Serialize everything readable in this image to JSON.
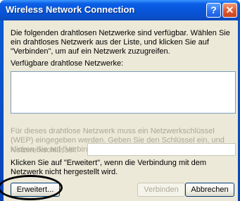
{
  "window": {
    "title": "Wireless Network Connection",
    "help_icon": "?",
    "close_icon": "✕"
  },
  "dialog": {
    "intro": "Die folgenden drahtlosen Netzwerke sind verfügbar. Wählen Sie ein drahtloses Netzwerk aus der Liste, und klicken Sie auf \"Verbinden\", um auf ein Netzwerk zuzugreifen.",
    "available_label": "Verfügbare drahtlose Netzwerke:",
    "available_networks": [],
    "wep_note": "Für dieses drahtlose Netzwerk muss ein Netzwerkschlüssel (WEP) eingegeben werden. Geben Sie den Schlüssel ein, und klicken Sie auf \"Verbinden\", um auf dieses Netzwerk zuzugreifen.",
    "key_label": "Netzwerkschlüssel:",
    "key_value": "",
    "advanced_note": "Klicken Sie auf \"Erweitert\", wenn die Verbindung mit dem Netzwerk nicht hergestellt wird."
  },
  "buttons": {
    "advanced": "Erweitert...",
    "connect": "Verbinden",
    "cancel": "Abbrechen"
  },
  "colors": {
    "titlebar": "#0754d9",
    "client_bg": "#ece9d8",
    "disabled_text": "#aca899",
    "highlight_circle": "#000000"
  }
}
